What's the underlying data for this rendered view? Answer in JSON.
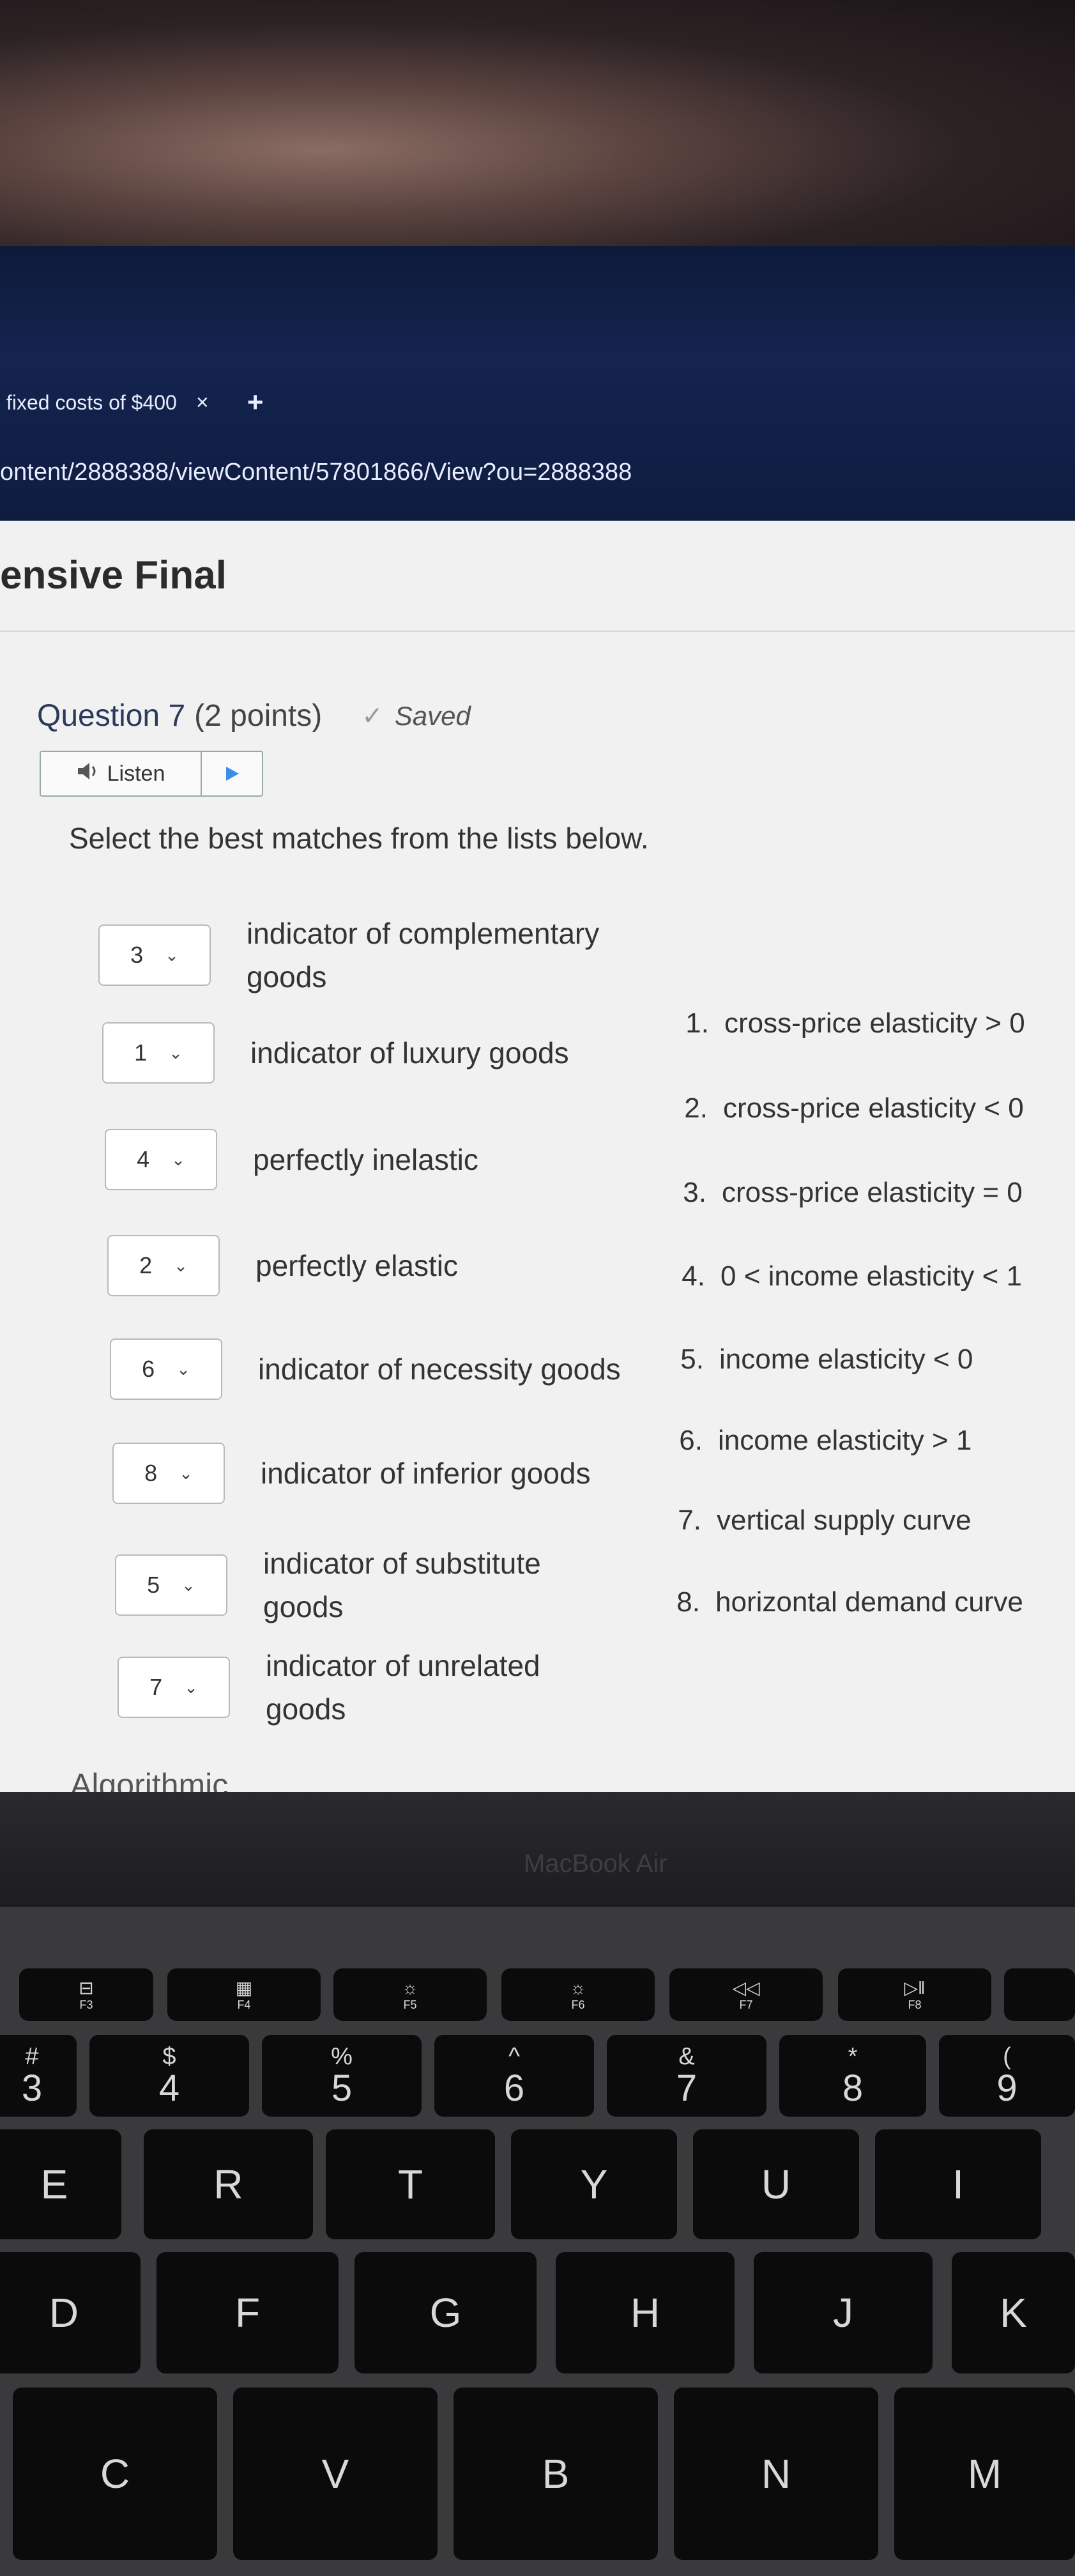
{
  "browser": {
    "tab_title": "fixed costs of $400",
    "tab_close": "×",
    "new_tab": "+",
    "url": "ontent/2888388/viewContent/57801866/View?ou=2888388"
  },
  "page": {
    "title": "ensive Final",
    "question_label": "Question 7",
    "points": "(2 points)",
    "saved_check": "✓",
    "saved": "Saved",
    "listen_label": "Listen",
    "instructions": "Select the best matches from the lists below.",
    "matches": [
      {
        "value": "3",
        "text": "indicator of complementary goods"
      },
      {
        "value": "1",
        "text": "indicator of luxury goods"
      },
      {
        "value": "4",
        "text": "perfectly inelastic"
      },
      {
        "value": "2",
        "text": "perfectly elastic"
      },
      {
        "value": "6",
        "text": "indicator of necessity goods"
      },
      {
        "value": "8",
        "text": "indicator of inferior goods"
      },
      {
        "value": "5",
        "text": "indicator of substitute goods"
      },
      {
        "value": "7",
        "text": "indicator of unrelated goods"
      }
    ],
    "options": [
      {
        "num": "1.",
        "text": "cross-price elasticity > 0"
      },
      {
        "num": "2.",
        "text": "cross-price elasticity < 0"
      },
      {
        "num": "3.",
        "text": "cross-price elasticity = 0"
      },
      {
        "num": "4.",
        "text": "0 < income elasticity < 1"
      },
      {
        "num": "5.",
        "text": "income elasticity < 0"
      },
      {
        "num": "6.",
        "text": "income elasticity > 1"
      },
      {
        "num": "7.",
        "text": "vertical supply curve"
      },
      {
        "num": "8.",
        "text": "horizontal demand curve"
      }
    ],
    "footer_partial": "Algorithmic"
  },
  "device": {
    "brand": "MacBook Air",
    "fkeys": [
      {
        "icon": "⊟",
        "label": "F3"
      },
      {
        "icon": "▦",
        "label": "F4"
      },
      {
        "icon": "☼",
        "label": "F5"
      },
      {
        "icon": "☼",
        "label": "F6"
      },
      {
        "icon": "◁◁",
        "label": "F7"
      },
      {
        "icon": "▷‖",
        "label": "F8"
      }
    ],
    "number_keys": [
      {
        "top": "#",
        "bot": "3"
      },
      {
        "top": "$",
        "bot": "4"
      },
      {
        "top": "%",
        "bot": "5"
      },
      {
        "top": "^",
        "bot": "6"
      },
      {
        "top": "&",
        "bot": "7"
      },
      {
        "top": "*",
        "bot": "8"
      },
      {
        "top": "(",
        "bot": "9"
      }
    ],
    "letter_row1": [
      "E",
      "R",
      "T",
      "Y",
      "U",
      "I"
    ],
    "letter_row2": [
      "D",
      "F",
      "G",
      "H",
      "J",
      "K"
    ],
    "letter_row3": [
      "C",
      "V",
      "B",
      "N",
      "M"
    ]
  }
}
